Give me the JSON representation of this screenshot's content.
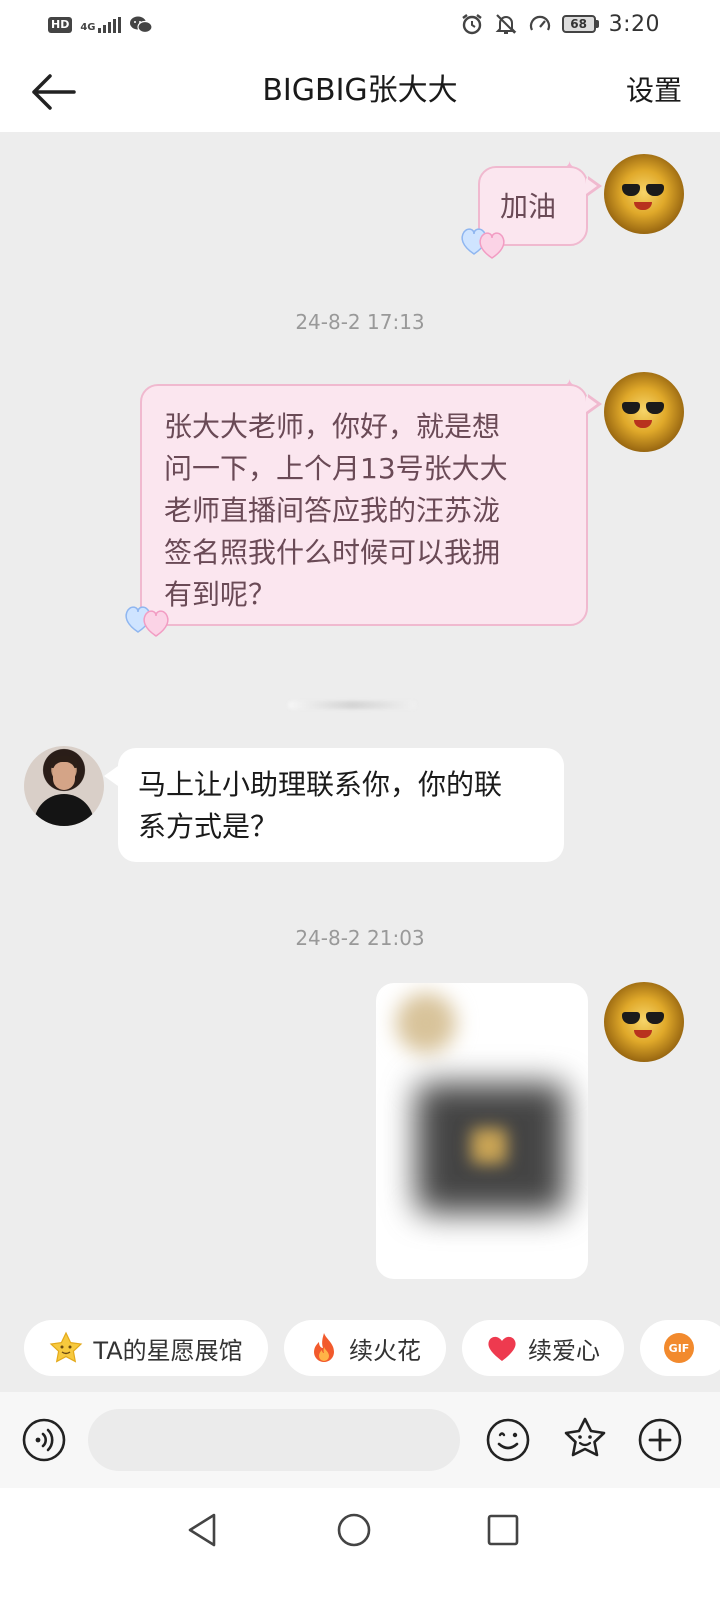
{
  "status_bar": {
    "hd": "HD",
    "network": "4G",
    "time": "3:20",
    "battery": "68"
  },
  "header": {
    "title": "BIGBIG张大大",
    "settings_label": "设置"
  },
  "messages": [
    {
      "side": "right",
      "type": "text",
      "text": "加油"
    },
    {
      "type": "timestamp",
      "text": "24-8-2 17:13"
    },
    {
      "side": "right",
      "type": "text",
      "lines": [
        "张大大老师，你好，就是想",
        "问一下，上个月13号张大大",
        "老师直播间答应我的汪苏泷",
        "签名照我什么时候可以我拥",
        "有到呢？"
      ]
    },
    {
      "side": "left",
      "type": "text",
      "lines": [
        "马上让小助理联系你，你的联",
        "系方式是？"
      ]
    },
    {
      "type": "timestamp",
      "text": "24-8-2 21:03"
    },
    {
      "side": "right",
      "type": "image"
    }
  ],
  "quick_actions": [
    {
      "label": "TA的星愿展馆",
      "icon": "star-face-icon"
    },
    {
      "label": "续火花",
      "icon": "fire-icon"
    },
    {
      "label": "续爱心",
      "icon": "heart-icon"
    },
    {
      "label": "GIF",
      "icon": "gif-icon"
    }
  ],
  "input": {
    "placeholder": ""
  },
  "colors": {
    "background": "#ededed",
    "my_bubble": "#fbe6ef",
    "my_bubble_border": "#f0b9cf",
    "other_bubble": "#ffffff",
    "timestamp": "#999999"
  }
}
